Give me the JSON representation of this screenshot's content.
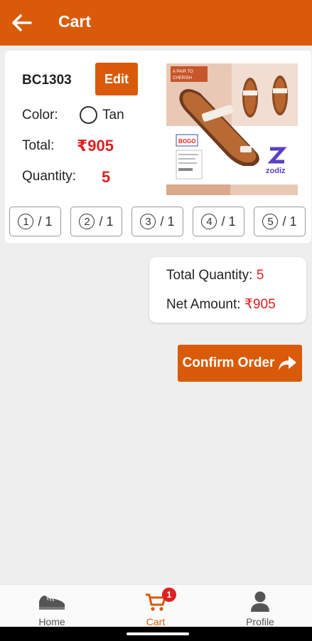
{
  "header": {
    "title": "Cart",
    "back_icon": "arrow-left-icon"
  },
  "colors": {
    "accent": "#d95b0a",
    "price_red": "#e02020"
  },
  "cart_item": {
    "code": "BC1303",
    "edit_label": "Edit",
    "color_label": "Color:",
    "color_value": "Tan",
    "total_label": "Total:",
    "total_value": "₹905",
    "quantity_label": "Quantity:",
    "quantity_value": "5",
    "image": {
      "brand": "zodiz",
      "banner_line1": "A PAIR TO",
      "banner_line2": "CHERISH",
      "tag": "BOGO"
    },
    "sizes": [
      {
        "size": "1",
        "qty": "/ 1"
      },
      {
        "size": "2",
        "qty": "/ 1"
      },
      {
        "size": "3",
        "qty": "/ 1"
      },
      {
        "size": "4",
        "qty": "/ 1"
      },
      {
        "size": "5",
        "qty": "/ 1"
      }
    ]
  },
  "summary": {
    "total_quantity_label": "Total Quantity:",
    "total_quantity_value": "5",
    "net_amount_label": "Net Amount:",
    "net_amount_value": "₹905"
  },
  "confirm_label": "Confirm Order",
  "nav": {
    "home": "Home",
    "cart": "Cart",
    "cart_badge": "1",
    "profile": "Profile"
  }
}
